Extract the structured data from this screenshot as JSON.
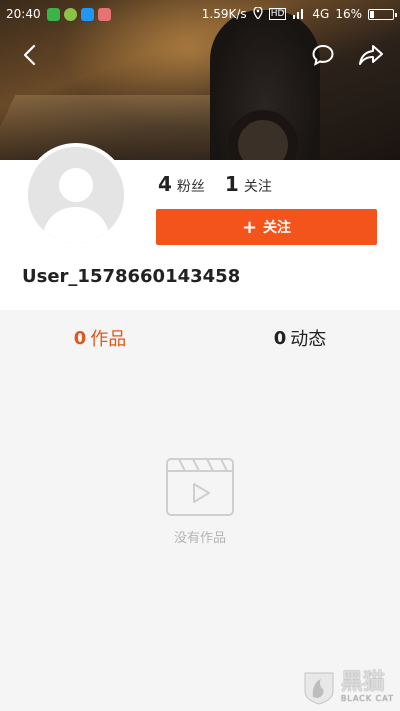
{
  "status_bar": {
    "time": "20:40",
    "network_speed": "1.59K/s",
    "network_type": "4G",
    "hd_label": "HD",
    "battery": "16%",
    "battery_level": 0.16
  },
  "header": {
    "back_icon": "chevron-left-icon",
    "comment_icon": "speech-bubble-icon",
    "share_icon": "share-arrow-icon"
  },
  "profile": {
    "fans_count": "4",
    "fans_label": "粉丝",
    "following_count": "1",
    "following_label": "关注",
    "follow_button_label": "关注",
    "username": "User_1578660143458"
  },
  "tabs": [
    {
      "count": "0",
      "label": "作品",
      "active": true
    },
    {
      "count": "0",
      "label": "动态",
      "active": false
    }
  ],
  "empty_state": {
    "icon": "video-clapper-icon",
    "text": "没有作品"
  },
  "watermark": {
    "title": "黑猫",
    "subtitle": "BLACK CAT"
  },
  "colors": {
    "accent": "#f2541b",
    "active_tab": "#e0581f"
  }
}
